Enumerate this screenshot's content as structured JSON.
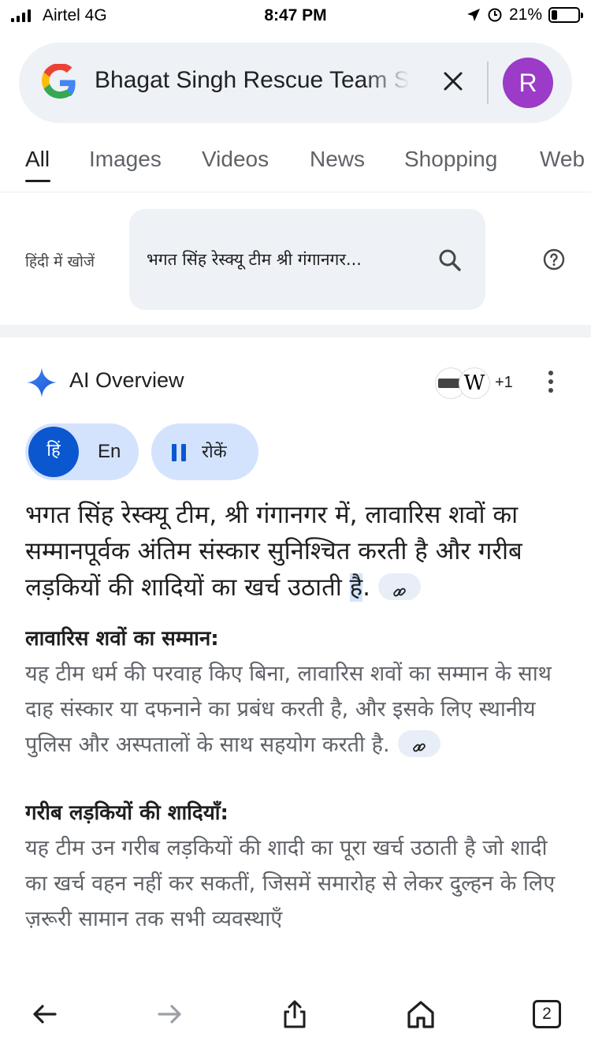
{
  "status_bar": {
    "carrier": "Airtel  4G",
    "time": "8:47 PM",
    "battery_text": "21%",
    "battery_level": 0.21
  },
  "search": {
    "query": "Bhagat Singh Rescue Team Shri Ganganagar",
    "avatar_letter": "R"
  },
  "tabs": [
    {
      "label": "All",
      "active": true
    },
    {
      "label": "Images"
    },
    {
      "label": "Videos"
    },
    {
      "label": "News"
    },
    {
      "label": "Shopping"
    },
    {
      "label": "Web"
    }
  ],
  "hindi_search": {
    "label": "हिंदी में खोजें",
    "query": "भगत सिंह रेस्क्यू टीम श्री गंगानगर..."
  },
  "ai_overview": {
    "title": "AI Overview",
    "extra_sources": "+1",
    "lang_hindi": "हिं",
    "lang_english": "En",
    "pause_label": "रोकें",
    "intro": "भगत सिंह रेस्क्यू टीम, श्री गंगानगर में, लावारिस शवों का सम्मानपूर्वक अंतिम संस्कार सुनिश्चित करती है और गरीब लड़कियों की शादियों का खर्च उठाती ",
    "intro_highlight": "है",
    "intro_end": ".",
    "sections": [
      {
        "heading": "लावारिस शवों का सम्मान:",
        "body": "यह टीम धर्म की परवाह किए बिना, लावारिस शवों का सम्मान के साथ दाह संस्कार या दफनाने का प्रबंध करती है, और इसके लिए स्थानीय पुलिस और अस्पतालों के साथ सहयोग करती है."
      },
      {
        "heading": "गरीब लड़कियों की शादियाँ:",
        "body": "यह टीम उन गरीब लड़कियों की शादी का पूरा खर्च उठाती है जो शादी का खर्च वहन नहीं कर सकतीं, जिसमें समारोह से लेकर दुल्हन के लिए ज़रूरी सामान तक सभी व्यवस्थाएँ"
      }
    ]
  },
  "toolbar": {
    "tab_count": "2"
  },
  "icons": [
    "signal-icon",
    "location-icon",
    "alarm-icon",
    "battery-icon",
    "google-logo",
    "clear-icon",
    "search-icon",
    "help-icon",
    "sparkle-icon",
    "link-icon",
    "more-icon",
    "pause-icon",
    "back-icon",
    "forward-icon",
    "share-icon",
    "home-icon"
  ],
  "colors": {
    "accent": "#0b57d0",
    "chip": "#d3e3fd",
    "avatar": "#9b3bc7",
    "search_bg": "#eef1f6"
  }
}
